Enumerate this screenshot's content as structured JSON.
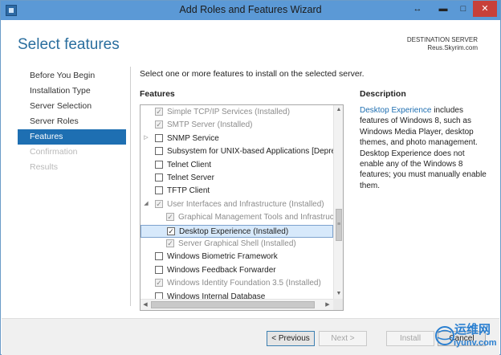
{
  "window": {
    "title": "Add Roles and Features Wizard",
    "controls": {
      "restore": "↔",
      "minimize": "▬",
      "maximize": "□",
      "close": "✕"
    }
  },
  "header": {
    "page_title": "Select features",
    "destination_label": "DESTINATION SERVER",
    "destination_server": "Reus.Skyrim.com"
  },
  "nav": {
    "items": [
      {
        "label": "Before You Begin",
        "state": "normal"
      },
      {
        "label": "Installation Type",
        "state": "normal"
      },
      {
        "label": "Server Selection",
        "state": "normal"
      },
      {
        "label": "Server Roles",
        "state": "normal"
      },
      {
        "label": "Features",
        "state": "active"
      },
      {
        "label": "Confirmation",
        "state": "disabled"
      },
      {
        "label": "Results",
        "state": "disabled"
      }
    ]
  },
  "main": {
    "instruction": "Select one or more features to install on the selected server.",
    "features_heading": "Features",
    "features": [
      {
        "label": "Simple TCP/IP Services (Installed)",
        "checked": true,
        "disabled": true,
        "indent": 1,
        "expander": ""
      },
      {
        "label": "SMTP Server (Installed)",
        "checked": true,
        "disabled": true,
        "indent": 1,
        "expander": ""
      },
      {
        "label": "SNMP Service",
        "checked": false,
        "disabled": false,
        "indent": 1,
        "expander": "▷"
      },
      {
        "label": "Subsystem for UNIX-based Applications [Deprecated]",
        "checked": false,
        "disabled": false,
        "indent": 1,
        "expander": ""
      },
      {
        "label": "Telnet Client",
        "checked": false,
        "disabled": false,
        "indent": 1,
        "expander": ""
      },
      {
        "label": "Telnet Server",
        "checked": false,
        "disabled": false,
        "indent": 1,
        "expander": ""
      },
      {
        "label": "TFTP Client",
        "checked": false,
        "disabled": false,
        "indent": 1,
        "expander": ""
      },
      {
        "label": "User Interfaces and Infrastructure (Installed)",
        "checked": true,
        "disabled": true,
        "indent": 1,
        "expander": "◢"
      },
      {
        "label": "Graphical Management Tools and Infrastructure",
        "checked": true,
        "disabled": true,
        "indent": 2,
        "expander": ""
      },
      {
        "label": "Desktop Experience (Installed)",
        "checked": true,
        "disabled": false,
        "indent": 2,
        "expander": "",
        "selected": true
      },
      {
        "label": "Server Graphical Shell (Installed)",
        "checked": true,
        "disabled": true,
        "indent": 2,
        "expander": ""
      },
      {
        "label": "Windows Biometric Framework",
        "checked": false,
        "disabled": false,
        "indent": 1,
        "expander": ""
      },
      {
        "label": "Windows Feedback Forwarder",
        "checked": false,
        "disabled": false,
        "indent": 1,
        "expander": ""
      },
      {
        "label": "Windows Identity Foundation 3.5 (Installed)",
        "checked": true,
        "disabled": true,
        "indent": 1,
        "expander": ""
      },
      {
        "label": "Windows Internal Database",
        "checked": false,
        "disabled": false,
        "indent": 1,
        "expander": ""
      }
    ],
    "scroll": {
      "up": "▲",
      "down": "▼",
      "left": "◀",
      "right": "▶",
      "grip": "≡"
    }
  },
  "description": {
    "heading": "Description",
    "link": "Desktop Experience",
    "text": " includes features of Windows 8, such as Windows Media Player, desktop themes, and photo management. Desktop Experience does not enable any of the Windows 8 features; you must manually enable them."
  },
  "footer": {
    "previous": "< Previous",
    "next": "Next >",
    "install": "Install",
    "cancel": "Cancel"
  },
  "watermark": {
    "line1": "运维网",
    "line2": "iyunv.com"
  },
  "colors": {
    "titlebar": "#5b99d6",
    "accent": "#1e6fb2",
    "heading": "#2a6e9e",
    "close": "#c7403a"
  }
}
